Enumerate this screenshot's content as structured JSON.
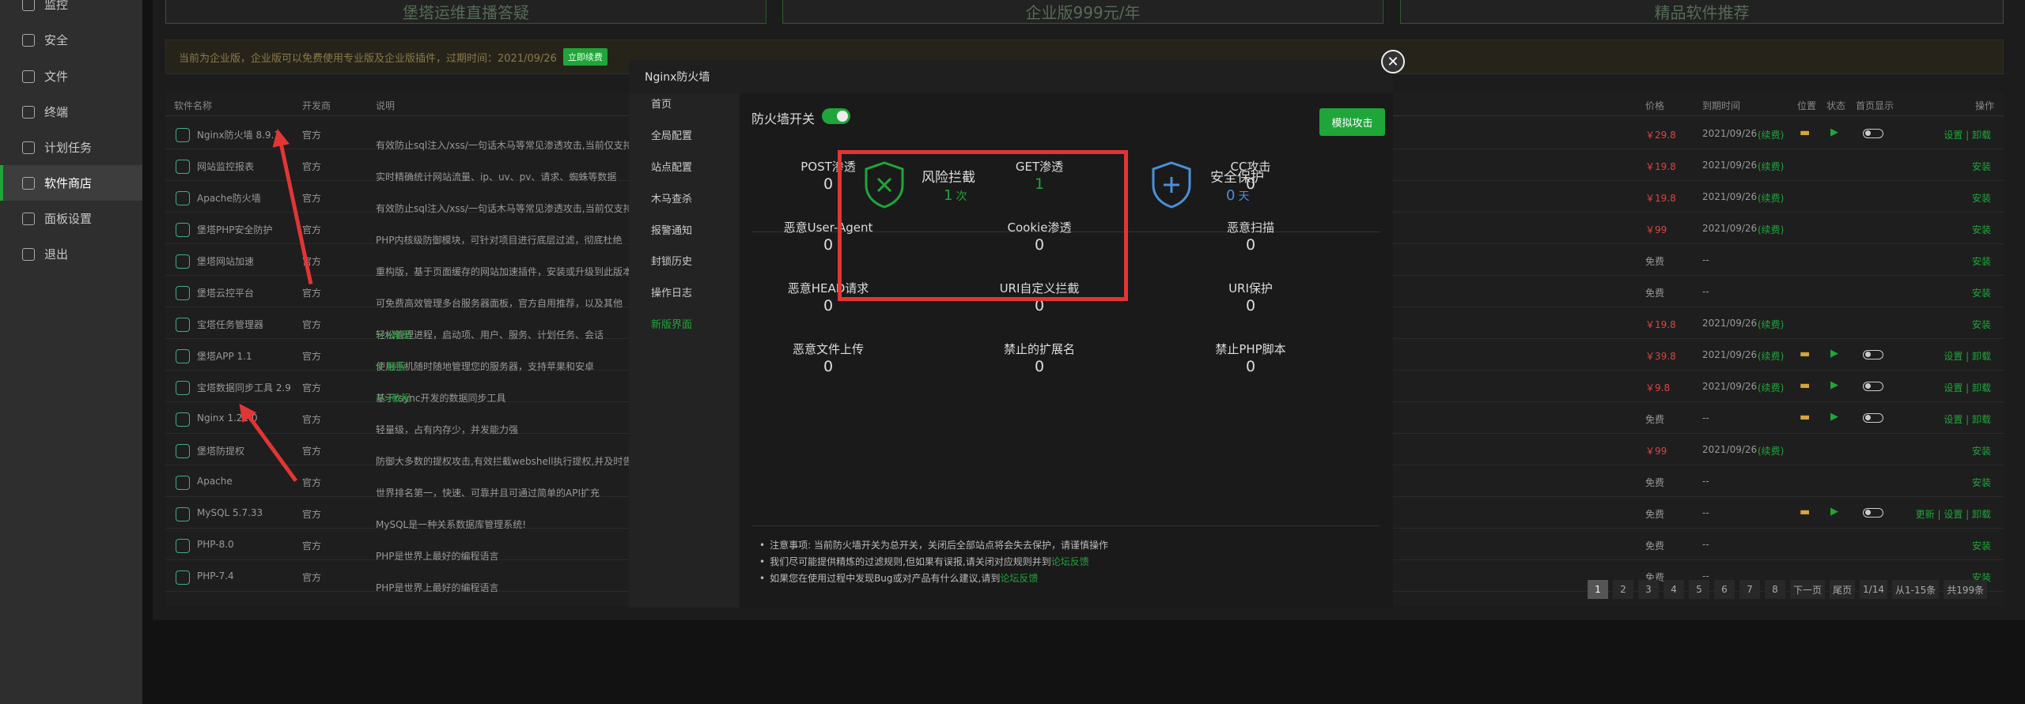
{
  "sidebar": {
    "items": [
      {
        "label": "监控",
        "icon": "monitor-icon"
      },
      {
        "label": "安全",
        "icon": "shield-icon"
      },
      {
        "label": "文件",
        "icon": "folder-icon"
      },
      {
        "label": "终端",
        "icon": "terminal-icon"
      },
      {
        "label": "计划任务",
        "icon": "clock-icon"
      },
      {
        "label": "软件商店",
        "icon": "store-icon",
        "active": true
      },
      {
        "label": "面板设置",
        "icon": "gear-icon"
      },
      {
        "label": "退出",
        "icon": "logout-icon"
      }
    ]
  },
  "top_cards": [
    "堡塔运维直播答疑",
    "企业版999元/年",
    "精品软件推荐"
  ],
  "alert": {
    "text": "当前为企业版，企业版可以免费使用专业版及企业版插件，过期时间：2021/09/26",
    "button": "立即续费"
  },
  "table": {
    "headers": {
      "name": "软件名称",
      "dev": "开发商",
      "desc": "说明",
      "price": "价格",
      "expire": "到期时间",
      "location": "位置",
      "status": "状态",
      "home": "首页显示",
      "ops": "操作"
    },
    "rows": [
      {
        "name": "Nginx防火墙 8.9.1",
        "dev": "官方",
        "desc": "有效防止sql注入/xss/一句话木马等常见渗透攻击,当前仅支持",
        "price": "￥29.8",
        "expire": "2021/09/26",
        "renew": "(续费)",
        "ops": "设置 | 卸载",
        "installed": true
      },
      {
        "name": "网站监控报表",
        "dev": "官方",
        "desc": "实时精确统计网站流量、ip、uv、pv、请求、蜘蛛等数据",
        "price": "￥19.8",
        "expire": "2021/09/26",
        "renew": "(续费)",
        "ops": "安装"
      },
      {
        "name": "Apache防火墙",
        "dev": "官方",
        "desc": "有效防止sql注入/xss/一句话木马等常见渗透攻击,当前仅支持",
        "price": "￥19.8",
        "expire": "2021/09/26",
        "renew": "(续费)",
        "ops": "安装"
      },
      {
        "name": "堡塔PHP安全防护",
        "dev": "官方",
        "desc": "PHP内核级防御模块，可针对项目进行底层过滤，彻底杜绝",
        "price": "￥99",
        "expire": "2021/09/26",
        "renew": "(续费)",
        "ops": "安装"
      },
      {
        "name": "堡塔网站加速",
        "dev": "官方",
        "desc": "重构版，基于页面缓存的网站加速插件，安装或升级到此版本",
        "price": "免费",
        "expire": "--",
        "renew": "",
        "ops": "安装"
      },
      {
        "name": "堡塔云控平台",
        "dev": "官方",
        "desc": "可免费高效管理多台服务器面板，官方自用推荐，以及其他",
        "price": "免费",
        "expire": "--",
        "renew": "",
        "ops": "安装"
      },
      {
        "name": "宝塔任务管理器",
        "dev": "官方",
        "desc": "轻松管理进程，启动项、用户、服务、计划任务、会话",
        "desc_link": ">>教程",
        "price": "￥19.8",
        "expire": "2021/09/26",
        "renew": "(续费)",
        "ops": "安装"
      },
      {
        "name": "堡塔APP 1.1",
        "dev": "官方",
        "desc": "使用手机随时随地管理您的服务器，支持苹果和安卓",
        "desc_link": "> 旧版",
        "price": "￥39.8",
        "expire": "2021/09/26",
        "renew": "(续费)",
        "ops": "设置 | 卸载",
        "installed": true
      },
      {
        "name": "宝塔数据同步工具 2.9",
        "dev": "官方",
        "desc": "基于rsync开发的数据同步工具",
        "desc_link": ">>教程",
        "price": "￥9.8",
        "expire": "2021/09/26",
        "renew": "(续费)",
        "ops": "设置 | 卸载",
        "installed": true
      },
      {
        "name": "Nginx 1.21.0",
        "dev": "官方",
        "desc": "轻量级，占有内存少，并发能力强",
        "price": "免费",
        "expire": "--",
        "renew": "",
        "ops": "设置 | 卸载",
        "installed": true
      },
      {
        "name": "堡塔防提权",
        "dev": "官方",
        "desc": "防御大多数的提权攻击,有效拦截webshell执行提权,并及时告",
        "price": "￥99",
        "expire": "2021/09/26",
        "renew": "(续费)",
        "ops": "安装"
      },
      {
        "name": "Apache",
        "dev": "官方",
        "desc": "世界排名第一，快速、可靠并且可通过简单的API扩充",
        "price": "免费",
        "expire": "--",
        "renew": "",
        "ops": "安装"
      },
      {
        "name": "MySQL 5.7.33",
        "dev": "官方",
        "desc": "MySQL是一种关系数据库管理系统!",
        "price": "免费",
        "expire": "--",
        "renew": "",
        "ops": "更新 | 设置 | 卸载",
        "installed": true
      },
      {
        "name": "PHP-8.0",
        "dev": "官方",
        "desc": "PHP是世界上最好的编程语言",
        "price": "免费",
        "expire": "--",
        "renew": "",
        "ops": "安装"
      },
      {
        "name": "PHP-7.4",
        "dev": "官方",
        "desc": "PHP是世界上最好的编程语言",
        "price": "免费",
        "expire": "--",
        "renew": "",
        "ops": "安装"
      }
    ]
  },
  "pager": {
    "pages": [
      "1",
      "2",
      "3",
      "4",
      "5",
      "6",
      "7",
      "8"
    ],
    "current": "1",
    "next": "下一页",
    "last": "尾页",
    "count": "1/14",
    "range": "从1-15条",
    "total": "共199条"
  },
  "modal": {
    "title": "Nginx防火墙",
    "close_icon": "close-icon",
    "menu": [
      "首页",
      "全局配置",
      "站点配置",
      "木马查杀",
      "报警通知",
      "封锁历史",
      "操作日志",
      "新版界面"
    ],
    "switch_label": "防火墙开关",
    "simulate_button": "模拟攻击",
    "summary": [
      {
        "label": "风险拦截",
        "value": "1",
        "unit": "次",
        "icon": "shield-x-icon",
        "color": "#20a53a"
      },
      {
        "label": "安全保护",
        "value": "0",
        "unit": "天",
        "icon": "shield-plus-icon",
        "color": "#4a90d9"
      }
    ],
    "stats": [
      {
        "label": "POST渗透",
        "value": "0"
      },
      {
        "label": "GET渗透",
        "value": "1",
        "green": true
      },
      {
        "label": "CC攻击",
        "value": "0"
      },
      {
        "label": "恶意User-Agent",
        "value": "0"
      },
      {
        "label": "Cookie渗透",
        "value": "0"
      },
      {
        "label": "恶意扫描",
        "value": "0"
      },
      {
        "label": "恶意HEAD请求",
        "value": "0"
      },
      {
        "label": "URI自定义拦截",
        "value": "0"
      },
      {
        "label": "URI保护",
        "value": "0"
      },
      {
        "label": "恶意文件上传",
        "value": "0"
      },
      {
        "label": "禁止的扩展名",
        "value": "0"
      },
      {
        "label": "禁止PHP脚本",
        "value": "0"
      }
    ],
    "notes": [
      {
        "text": "注意事项: 当前防火墙开关为总开关，关闭后全部站点将会失去保护，请谨慎操作",
        "link": ""
      },
      {
        "text": "我们尽可能提供精炼的过滤规则,但如果有误报,请关闭对应规则并到",
        "link": "论坛反馈"
      },
      {
        "text": "如果您在使用过程中发现Bug或对产品有什么建议,请到",
        "link": "论坛反馈"
      }
    ]
  },
  "colors": {
    "accent": "#20a53a",
    "highlight": "#e23535",
    "price": "#d44"
  }
}
